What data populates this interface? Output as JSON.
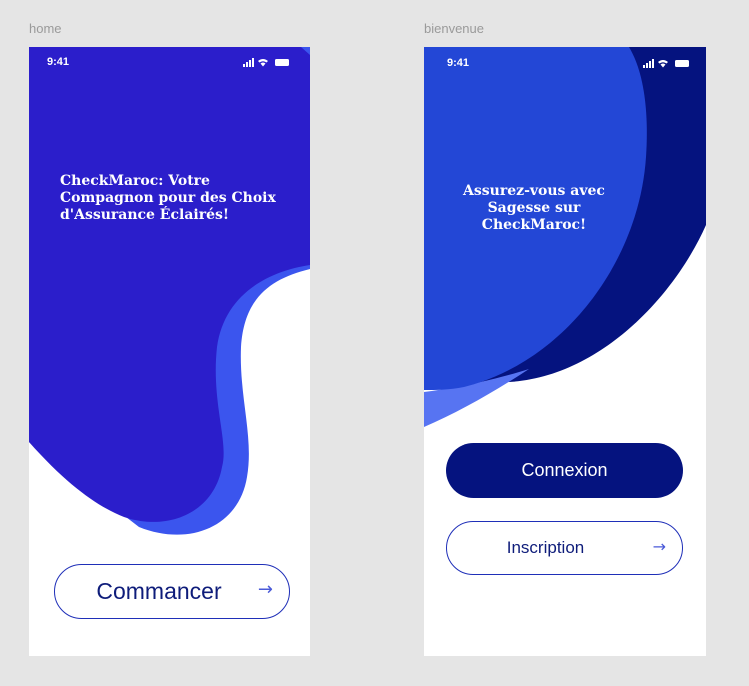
{
  "frames": {
    "home": {
      "label": "home",
      "status_time": "9:41",
      "headline": "CheckMaroc: Votre Compagnon pour des Choix d'Assurance Éclairés!",
      "start_button_label": "Commancer",
      "start_button_icon": "arrow-right-icon"
    },
    "bienvenue": {
      "label": "bienvenue",
      "status_time": "9:41",
      "headline": "Assurez-vous avec Sagesse sur CheckMaroc!",
      "login_button_label": "Connexion",
      "signup_button_label": "Inscription",
      "signup_button_icon": "arrow-right-icon"
    }
  },
  "colors": {
    "primary_purple": "#2b1ecb",
    "accent_blue": "#3b55ee",
    "navy": "#05137f",
    "royal_blue": "#2347d6",
    "light_blue": "#5774f2"
  }
}
